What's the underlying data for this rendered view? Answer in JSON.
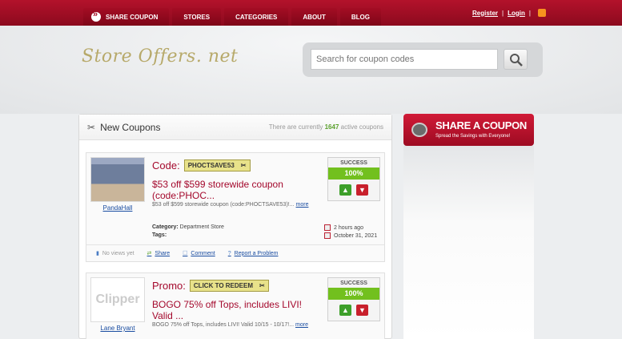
{
  "nav": {
    "items": [
      "SHARE COUPON",
      "STORES",
      "CATEGORIES",
      "ABOUT",
      "BLOG"
    ]
  },
  "toplinks": {
    "register": "Register",
    "sep": "|",
    "login": "Login"
  },
  "logo": "Store Offers. net",
  "search": {
    "placeholder": "Search for coupon codes"
  },
  "main": {
    "title": "New Coupons",
    "count_prefix": "There are currently",
    "count": "1647",
    "count_suffix": "active coupons"
  },
  "coupons": [
    {
      "store": "PandaHall",
      "type": "Code:",
      "code": "PHOCTSAVE53",
      "title": "$53 off $599 storewide coupon (code:PHOC...",
      "desc": "$53 off $599 storewide coupon (code:PHOCTSAVE53)!...",
      "more": "more",
      "category_label": "Category:",
      "category": "Department Store",
      "tags_label": "Tags:",
      "time_ago": "2 hours ago",
      "date": "October 31, 2021",
      "success_label": "SUCCESS",
      "success_value": "100%",
      "views": "No views yet",
      "share": "Share",
      "comment": "Comment",
      "report": "Report a Problem"
    },
    {
      "store": "Lane Bryant",
      "type": "Promo:",
      "code": "CLICK TO REDEEM",
      "title": "BOGO 75% off Tops, includes LIVI! Valid ...",
      "desc": "BOGO 75% off Tops, includes LIVI! Valid 10/15 - 10/17!...",
      "more": "more",
      "thumb_text": "Clipper",
      "success_label": "SUCCESS",
      "success_value": "100%"
    }
  ],
  "share_box": {
    "title": "SHARE A COUPON",
    "subtitle": "Spread the Savings with Everyone!"
  }
}
